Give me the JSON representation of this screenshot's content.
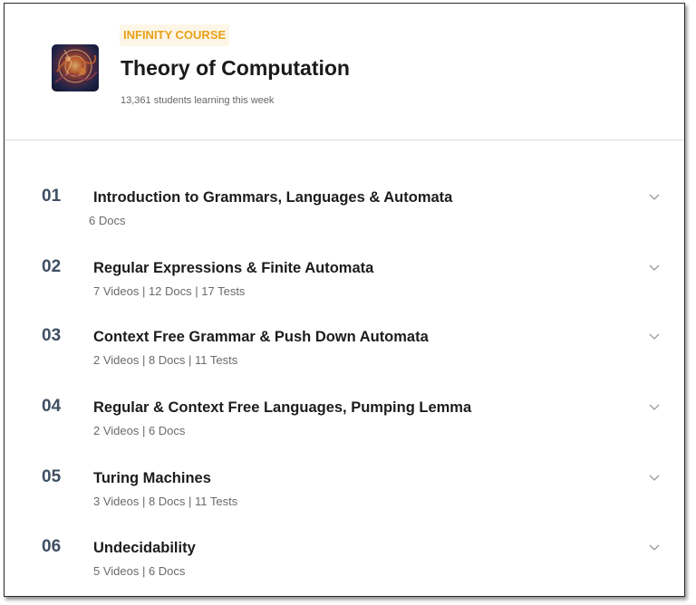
{
  "course": {
    "badge": "INFINITY COURSE",
    "title": "Theory of Computation",
    "students": "13,361 students learning this week"
  },
  "chapters": [
    {
      "number": "01",
      "title": "Introduction to Grammars, Languages & Automata",
      "meta": "6 Docs"
    },
    {
      "number": "02",
      "title": "Regular Expressions & Finite Automata",
      "meta": "7 Videos  | 12 Docs | 17 Tests"
    },
    {
      "number": "03",
      "title": "Context Free Grammar & Push Down Automata",
      "meta": "2 Videos  | 8 Docs | 11 Tests"
    },
    {
      "number": "04",
      "title": "Regular & Context Free Languages, Pumping Lemma",
      "meta": "2 Videos  | 6 Docs"
    },
    {
      "number": "05",
      "title": "Turing Machines",
      "meta": "3 Videos  | 8 Docs | 11 Tests"
    },
    {
      "number": "06",
      "title": "Undecidability",
      "meta": "5 Videos  | 6 Docs"
    }
  ],
  "icons": {
    "expand": "chevron-down-icon",
    "thumbnail": "course-thumbnail"
  },
  "colors": {
    "badge_text": "#e8a21a",
    "badge_bg": "#fdf6e6",
    "chapter_number": "#3e4f63"
  }
}
